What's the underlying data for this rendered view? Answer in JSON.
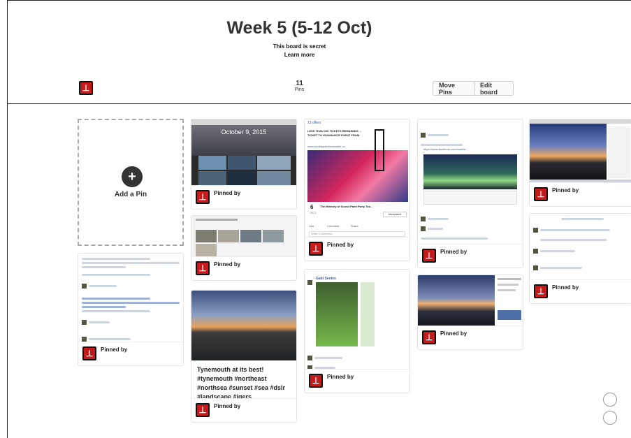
{
  "board": {
    "title": "Week 5 (5-12 Oct)",
    "secret_text": "This board is secret",
    "learn_more": "Learn more",
    "pin_count": "11",
    "pin_count_label": "Pins",
    "move_pins": "Move Pins",
    "edit_board": "Edit board"
  },
  "add_pin": {
    "label": "Add a Pin",
    "icon": "plus-icon"
  },
  "pins": {
    "pinned_by": "Pinned by",
    "tynemouth_caption": "Tynemouth at its best! #tynemouth #northeast #northsea #sunset #sea #dslr #landscape #igers #photooftheday #facebook",
    "calendar_date": "October 9, 2015",
    "event_title": "The Ministry of Sound Paint Party Tou...",
    "event_day": "6",
    "event_month": "OCT",
    "event_link": "www.societypaintnewcastle.co",
    "event_banner": "LESS THAN 100 TICKETS REMAINING ... TICKET TO IGUANAVICE EVENT FROM",
    "event_offers": "13 offers",
    "interested": "Interested",
    "like": "Like",
    "comment": "Comment",
    "share": "Share",
    "write_comment": "Write a comment...",
    "chat_aurora_link": "https://www.facebook.com/events/...",
    "chat_name": "Gabi Sentes"
  },
  "colors": {
    "pin_red": "#c41c1c",
    "night_blue": "#1b2a55",
    "sunset_orange": "#e68a3a"
  }
}
